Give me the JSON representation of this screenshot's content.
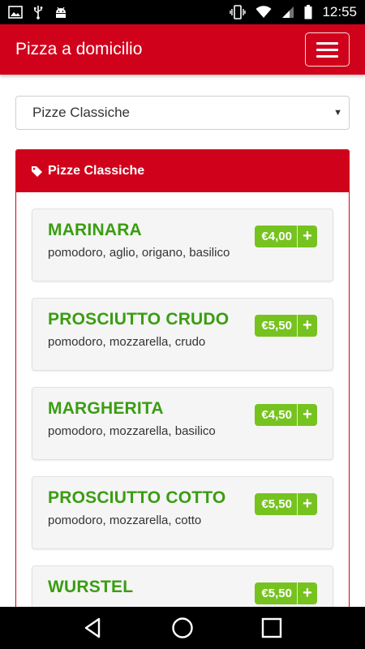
{
  "status_bar": {
    "time": "12:55"
  },
  "navbar": {
    "title": "Pizza a domicilio"
  },
  "category_select": {
    "selected": "Pizze Classiche"
  },
  "panel": {
    "title": "Pizze Classiche"
  },
  "items": [
    {
      "name": "MARINARA",
      "description": "pomodoro, aglio, origano, basilico",
      "price": "€4,00"
    },
    {
      "name": "PROSCIUTTO CRUDO",
      "description": "pomodoro, mozzarella, crudo",
      "price": "€5,50"
    },
    {
      "name": "MARGHERITA",
      "description": "pomodoro, mozzarella, basilico",
      "price": "€4,50"
    },
    {
      "name": "PROSCIUTTO COTTO",
      "description": "pomodoro, mozzarella, cotto",
      "price": "€5,50"
    },
    {
      "name": "WURSTEL",
      "description": "",
      "price": "€5,50"
    }
  ],
  "colors": {
    "brand_red": "#d0021b",
    "item_green": "#3a9d12",
    "price_green": "#76c31f"
  },
  "icons": {
    "panel": "tag-icon",
    "add": "plus-icon"
  }
}
